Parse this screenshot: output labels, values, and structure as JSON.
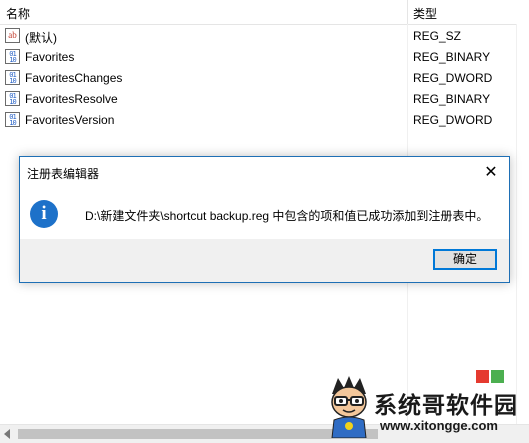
{
  "columns": {
    "name": "名称",
    "type": "类型"
  },
  "rows": [
    {
      "icon": "string-value-icon",
      "glyph": "ab",
      "name": "(默认)",
      "type": "REG_SZ"
    },
    {
      "icon": "binary-value-icon",
      "glyph": "011\n110",
      "name": "Favorites",
      "type": "REG_BINARY"
    },
    {
      "icon": "binary-value-icon",
      "glyph": "011\n110",
      "name": "FavoritesChanges",
      "type": "REG_DWORD"
    },
    {
      "icon": "binary-value-icon",
      "glyph": "011\n110",
      "name": "FavoritesResolve",
      "type": "REG_BINARY"
    },
    {
      "icon": "binary-value-icon",
      "glyph": "011\n110",
      "name": "FavoritesVersion",
      "type": "REG_DWORD"
    }
  ],
  "dialog": {
    "title": "注册表编辑器",
    "close_glyph": "✕",
    "info_glyph": "i",
    "message": "D:\\新建文件夹\\shortcut backup.reg 中包含的项和值已成功添加到注册表中。",
    "ok_label": "确定"
  },
  "watermark": {
    "brand": "系统哥软件园",
    "url": "www.xitongge.com",
    "colors": {
      "red": "#e53a2f",
      "green": "#4caf50"
    }
  }
}
